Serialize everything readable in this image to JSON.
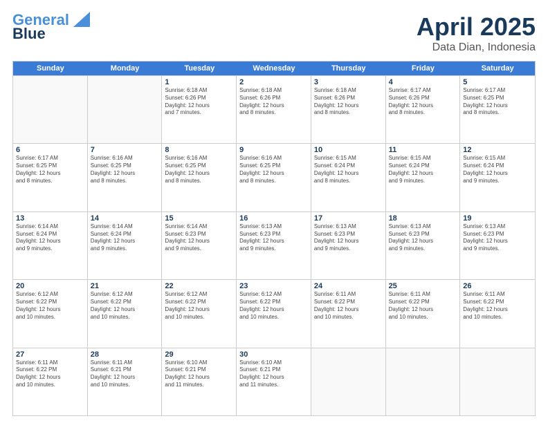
{
  "header": {
    "logo_line1": "General",
    "logo_line2": "Blue",
    "title": "April 2025",
    "subtitle": "Data Dian, Indonesia"
  },
  "days_of_week": [
    "Sunday",
    "Monday",
    "Tuesday",
    "Wednesday",
    "Thursday",
    "Friday",
    "Saturday"
  ],
  "weeks": [
    [
      {
        "day": "",
        "info": ""
      },
      {
        "day": "",
        "info": ""
      },
      {
        "day": "1",
        "info": "Sunrise: 6:18 AM\nSunset: 6:26 PM\nDaylight: 12 hours\nand 7 minutes."
      },
      {
        "day": "2",
        "info": "Sunrise: 6:18 AM\nSunset: 6:26 PM\nDaylight: 12 hours\nand 8 minutes."
      },
      {
        "day": "3",
        "info": "Sunrise: 6:18 AM\nSunset: 6:26 PM\nDaylight: 12 hours\nand 8 minutes."
      },
      {
        "day": "4",
        "info": "Sunrise: 6:17 AM\nSunset: 6:26 PM\nDaylight: 12 hours\nand 8 minutes."
      },
      {
        "day": "5",
        "info": "Sunrise: 6:17 AM\nSunset: 6:25 PM\nDaylight: 12 hours\nand 8 minutes."
      }
    ],
    [
      {
        "day": "6",
        "info": "Sunrise: 6:17 AM\nSunset: 6:25 PM\nDaylight: 12 hours\nand 8 minutes."
      },
      {
        "day": "7",
        "info": "Sunrise: 6:16 AM\nSunset: 6:25 PM\nDaylight: 12 hours\nand 8 minutes."
      },
      {
        "day": "8",
        "info": "Sunrise: 6:16 AM\nSunset: 6:25 PM\nDaylight: 12 hours\nand 8 minutes."
      },
      {
        "day": "9",
        "info": "Sunrise: 6:16 AM\nSunset: 6:25 PM\nDaylight: 12 hours\nand 8 minutes."
      },
      {
        "day": "10",
        "info": "Sunrise: 6:15 AM\nSunset: 6:24 PM\nDaylight: 12 hours\nand 8 minutes."
      },
      {
        "day": "11",
        "info": "Sunrise: 6:15 AM\nSunset: 6:24 PM\nDaylight: 12 hours\nand 9 minutes."
      },
      {
        "day": "12",
        "info": "Sunrise: 6:15 AM\nSunset: 6:24 PM\nDaylight: 12 hours\nand 9 minutes."
      }
    ],
    [
      {
        "day": "13",
        "info": "Sunrise: 6:14 AM\nSunset: 6:24 PM\nDaylight: 12 hours\nand 9 minutes."
      },
      {
        "day": "14",
        "info": "Sunrise: 6:14 AM\nSunset: 6:24 PM\nDaylight: 12 hours\nand 9 minutes."
      },
      {
        "day": "15",
        "info": "Sunrise: 6:14 AM\nSunset: 6:23 PM\nDaylight: 12 hours\nand 9 minutes."
      },
      {
        "day": "16",
        "info": "Sunrise: 6:13 AM\nSunset: 6:23 PM\nDaylight: 12 hours\nand 9 minutes."
      },
      {
        "day": "17",
        "info": "Sunrise: 6:13 AM\nSunset: 6:23 PM\nDaylight: 12 hours\nand 9 minutes."
      },
      {
        "day": "18",
        "info": "Sunrise: 6:13 AM\nSunset: 6:23 PM\nDaylight: 12 hours\nand 9 minutes."
      },
      {
        "day": "19",
        "info": "Sunrise: 6:13 AM\nSunset: 6:23 PM\nDaylight: 12 hours\nand 9 minutes."
      }
    ],
    [
      {
        "day": "20",
        "info": "Sunrise: 6:12 AM\nSunset: 6:22 PM\nDaylight: 12 hours\nand 10 minutes."
      },
      {
        "day": "21",
        "info": "Sunrise: 6:12 AM\nSunset: 6:22 PM\nDaylight: 12 hours\nand 10 minutes."
      },
      {
        "day": "22",
        "info": "Sunrise: 6:12 AM\nSunset: 6:22 PM\nDaylight: 12 hours\nand 10 minutes."
      },
      {
        "day": "23",
        "info": "Sunrise: 6:12 AM\nSunset: 6:22 PM\nDaylight: 12 hours\nand 10 minutes."
      },
      {
        "day": "24",
        "info": "Sunrise: 6:11 AM\nSunset: 6:22 PM\nDaylight: 12 hours\nand 10 minutes."
      },
      {
        "day": "25",
        "info": "Sunrise: 6:11 AM\nSunset: 6:22 PM\nDaylight: 12 hours\nand 10 minutes."
      },
      {
        "day": "26",
        "info": "Sunrise: 6:11 AM\nSunset: 6:22 PM\nDaylight: 12 hours\nand 10 minutes."
      }
    ],
    [
      {
        "day": "27",
        "info": "Sunrise: 6:11 AM\nSunset: 6:22 PM\nDaylight: 12 hours\nand 10 minutes."
      },
      {
        "day": "28",
        "info": "Sunrise: 6:11 AM\nSunset: 6:21 PM\nDaylight: 12 hours\nand 10 minutes."
      },
      {
        "day": "29",
        "info": "Sunrise: 6:10 AM\nSunset: 6:21 PM\nDaylight: 12 hours\nand 11 minutes."
      },
      {
        "day": "30",
        "info": "Sunrise: 6:10 AM\nSunset: 6:21 PM\nDaylight: 12 hours\nand 11 minutes."
      },
      {
        "day": "",
        "info": ""
      },
      {
        "day": "",
        "info": ""
      },
      {
        "day": "",
        "info": ""
      }
    ]
  ]
}
